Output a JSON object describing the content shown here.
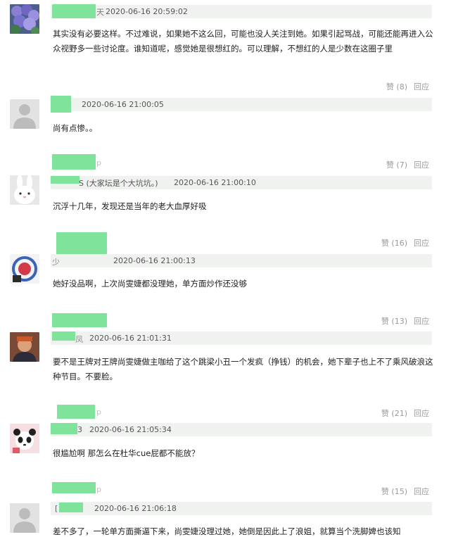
{
  "comments": [
    {
      "username_fragment": "天",
      "timestamp": "2020-06-16 20:59:02",
      "text": "其实没有必要这样。不过难说，如果她不这么回，可能也没人关注到她。如果引起骂战，可能还能再进入公众视野多一些讨论度。谁知道呢，感觉她是很想红的。可以理解，不想红的人是少数在这圈子里",
      "likes_label": "赞 (8)",
      "reply_label": "回应",
      "avatar": "hydrangea-flowers-avatar"
    },
    {
      "username_fragment": "",
      "timestamp": "2020-06-16 21:00:05",
      "text": "尚有点惨。。",
      "likes_label": "赞 (7)",
      "reply_label": "回应",
      "avatar": "default-user-avatar"
    },
    {
      "username_fragment": "p",
      "username_sub": "S (大家坛是个大坑坑。)",
      "timestamp": "2020-06-16 21:00:10",
      "text": "沉浮十几年，发现还是当年的老大血厚好吸",
      "likes_label": "赞 (16)",
      "reply_label": "回应",
      "avatar": "white-rabbit-avatar"
    },
    {
      "username_fragment": "",
      "username_sub": "少",
      "timestamp": "2020-06-16 21:00:13",
      "text": "她好没品啊，上次尚雯婕都没理她，单方面炒作还没够",
      "likes_label": "赞 (13)",
      "reply_label": "回应",
      "avatar": "cartoon-circle-avatar"
    },
    {
      "username_fragment": "凤",
      "timestamp": "2020-06-16 21:01:31",
      "text": "要不是王牌对王牌尚雯婕做主咖给了这个跳梁小丑一个发疯（挣钱）的机会，她下辈子也上不了乘风破浪这种节目。不要脸。",
      "likes_label": "赞 (21)",
      "reply_label": "回应",
      "avatar": "person-photo-avatar"
    },
    {
      "username_fragment": "p",
      "username_sub": "3",
      "timestamp": "2020-06-16 21:05:34",
      "text": "很尴尬啊 那怎么在杜华cue屁都不能放？",
      "likes_label": "赞 (15)",
      "reply_label": "回应",
      "avatar": "panda-avatar"
    },
    {
      "username_fragment": "p",
      "username_sub": "[",
      "timestamp": "2020-06-16 21:06:18",
      "text": "差不多了，一轮单方面撕逼下来，尚雯婕没理过她，她倒是因此上了浪姐，就算当个洗脚婢也该知",
      "avatar": "default-user-avatar"
    }
  ],
  "colors": {
    "redaction_green": "#7fe39b",
    "meta_bar": "#f0f2f0",
    "action_gray": "#9a9a9a"
  }
}
